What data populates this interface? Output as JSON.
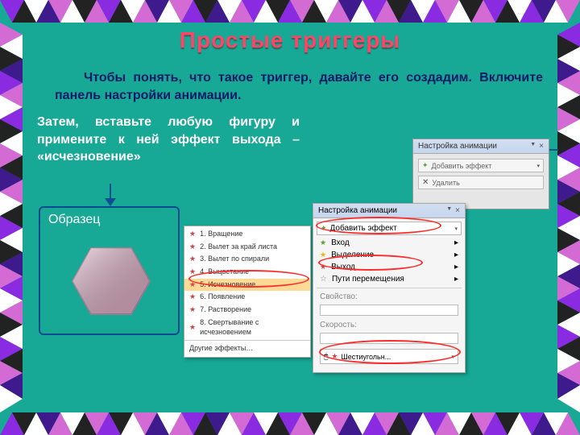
{
  "title": "Простые триггеры",
  "paragraph1": "Чтобы понять, что такое триггер, давайте его создадим.  Включите панель настройки анимации.",
  "paragraph2": "Затем, вставьте любую фигуру и примените к ней эффект выхода – «исчезновение»",
  "sample_label": "Образец",
  "anim_panel": {
    "title": "Настройка анимации",
    "add_effect": "Добавить эффект",
    "remove": "Удалить"
  },
  "menu_panel": {
    "title": "Настройка анимации",
    "add_effect": "Добавить эффект",
    "items": {
      "entrance": "Вход",
      "emphasis": "Выделение",
      "exit": "Выход",
      "motion": "Пути перемещения"
    },
    "property": "Свойство:",
    "speed": "Скорость:",
    "effect_row": "Шестиугольн..."
  },
  "effects_list": [
    "1. Вращение",
    "2. Вылет за край листа",
    "3. Вылет по спирали",
    "4. Выцветание",
    "5. Исчезновение",
    "6. Появление",
    "7. Растворение",
    "8. Свертывание с исчезновением",
    "Другие эффекты…"
  ]
}
